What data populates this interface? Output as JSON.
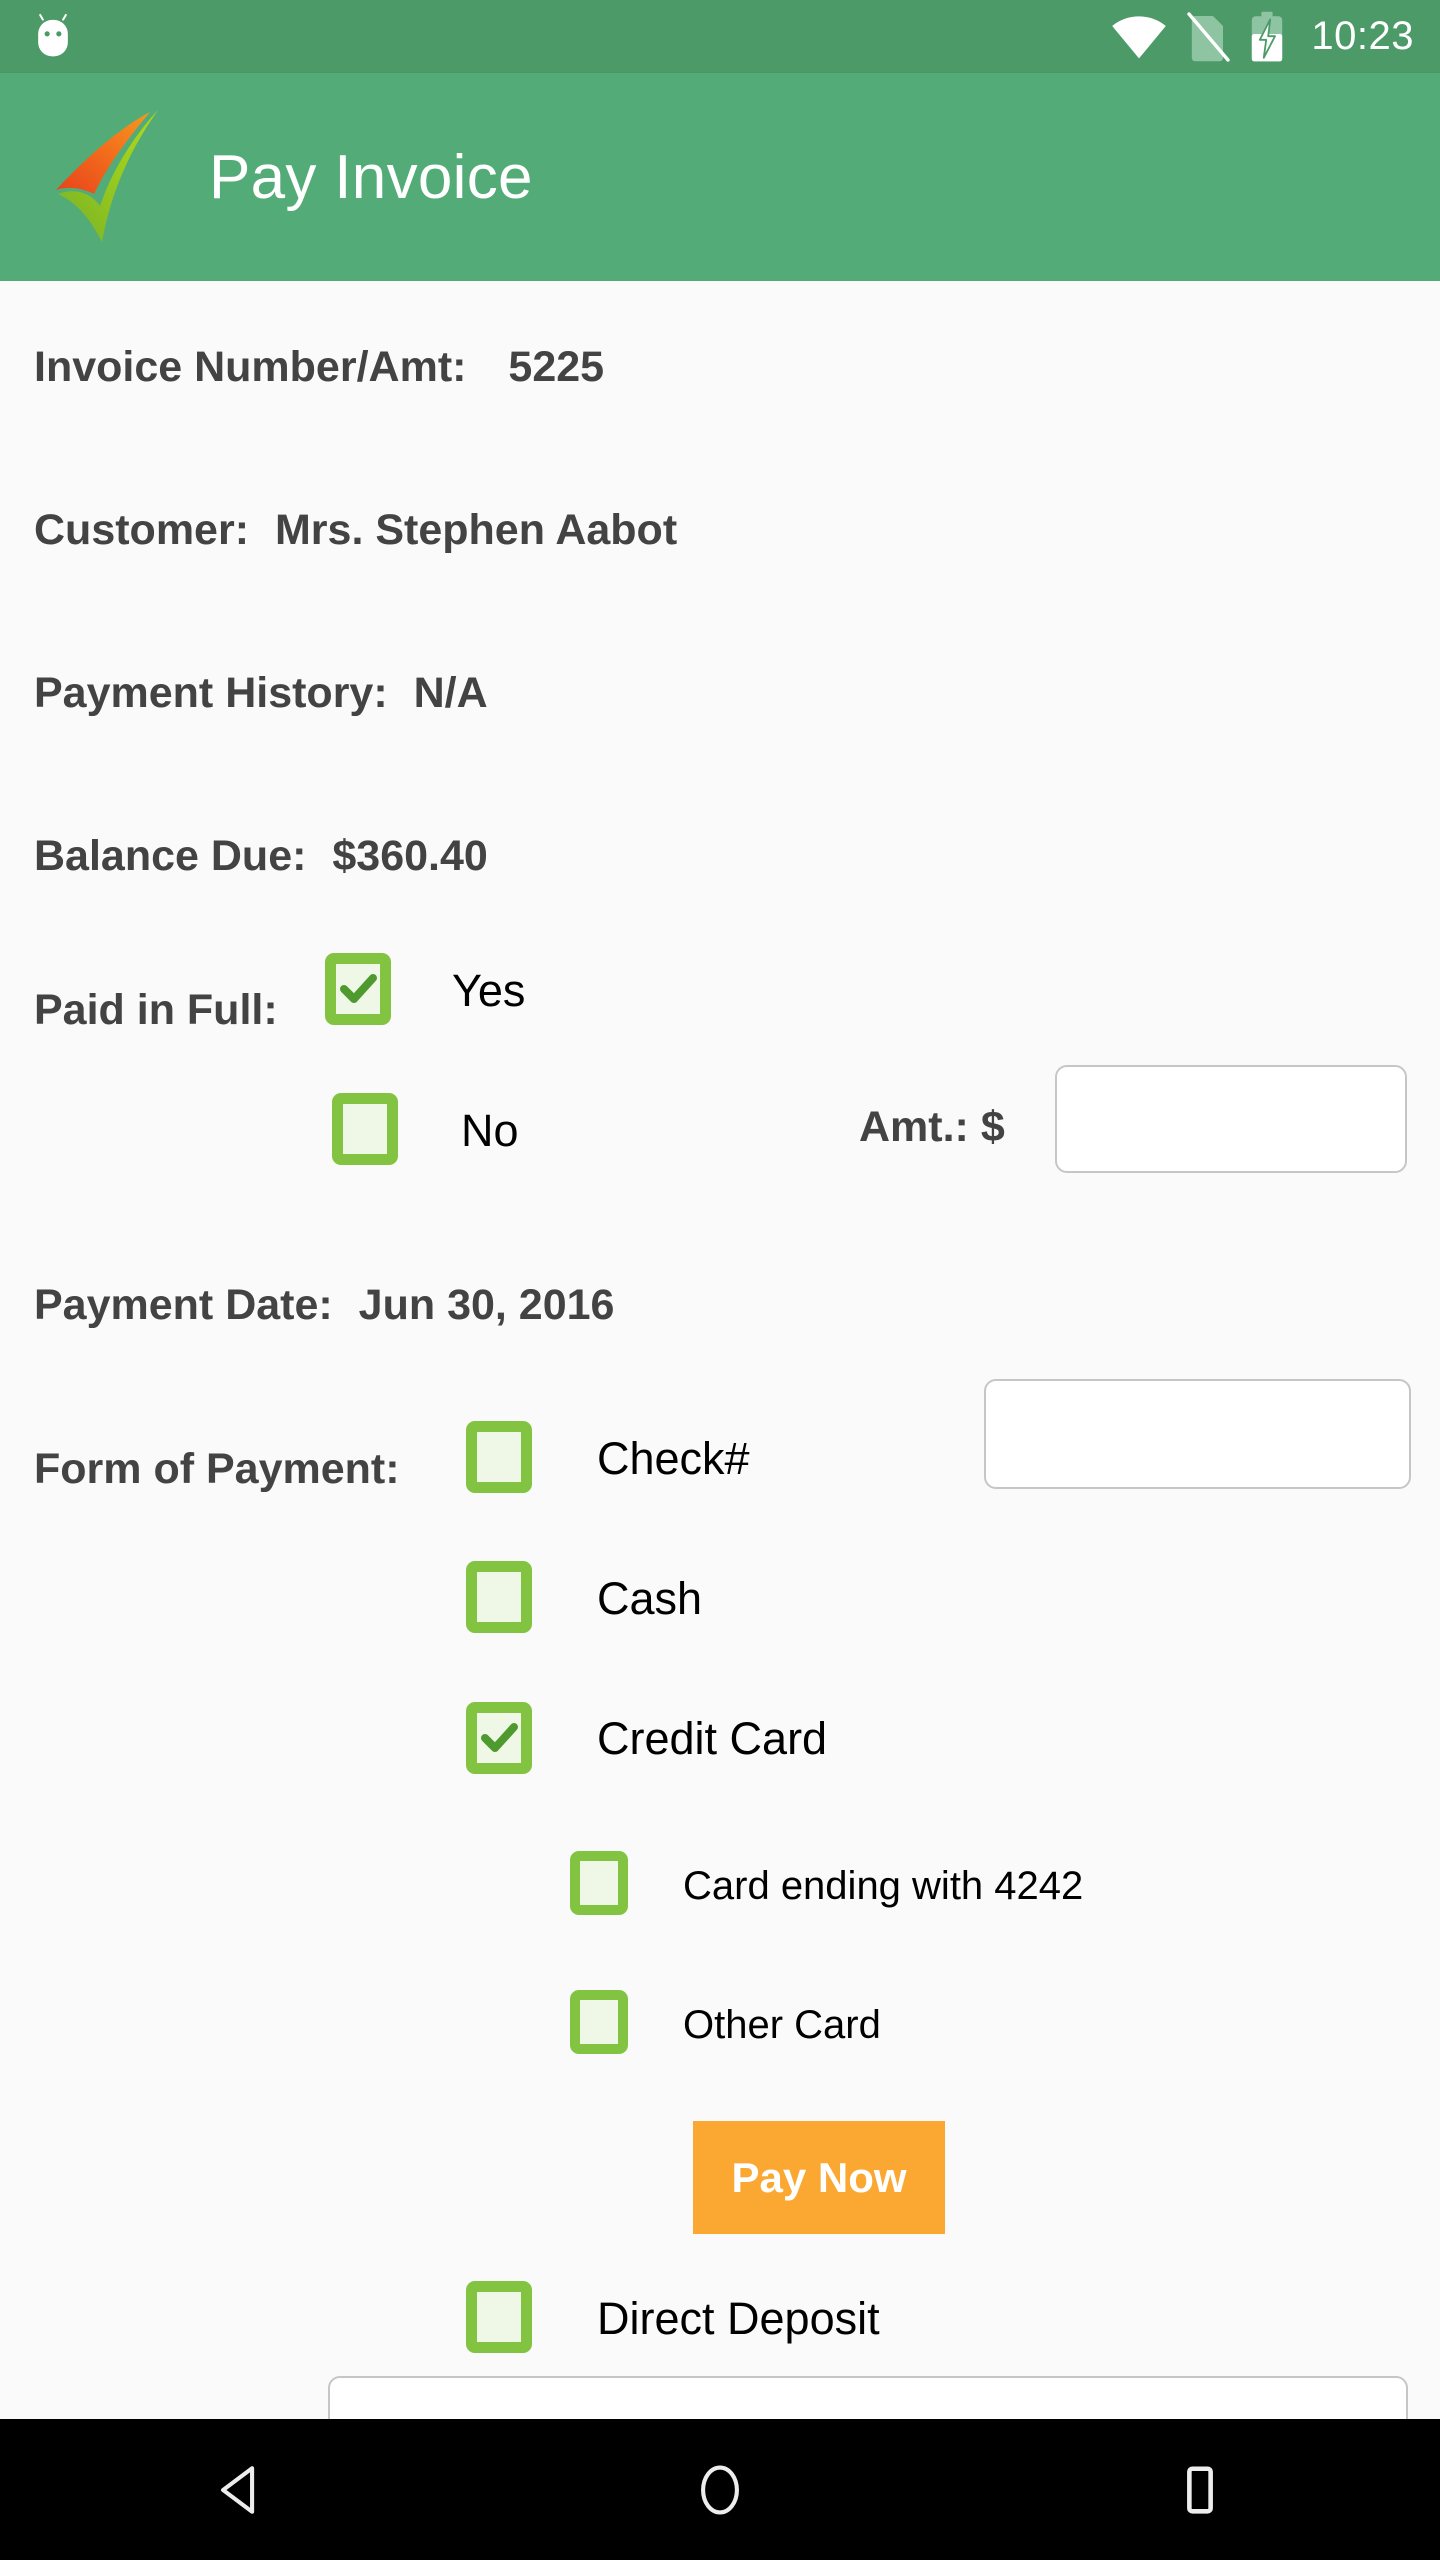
{
  "status_bar": {
    "clock": "10:23",
    "icons": [
      "wifi-icon",
      "no-sim-icon",
      "battery-charging-icon"
    ],
    "background_color": "#4C9A68"
  },
  "app_bar": {
    "title": "Pay Invoice",
    "logo_name": "swoosh-check-logo",
    "background_color": "#53AC77",
    "title_color": "#FFFFFF"
  },
  "form": {
    "invoice": {
      "label": "Invoice Number/Amt:",
      "value": "5225"
    },
    "customer": {
      "label": "Customer:",
      "value": "Mrs. Stephen Aabot"
    },
    "payment_history": {
      "label": "Payment History:",
      "value": "N/A"
    },
    "balance_due": {
      "label": "Balance Due:",
      "value": "$360.40"
    },
    "paid_in_full": {
      "label": "Paid in Full:",
      "options": [
        {
          "label": "Yes",
          "checked": true
        },
        {
          "label": "No",
          "checked": false
        }
      ],
      "amount": {
        "label": "Amt.: $",
        "value": "",
        "placeholder": ""
      }
    },
    "payment_date": {
      "label": "Payment Date:",
      "value": "Jun 30, 2016"
    },
    "form_of_payment": {
      "label": "Form of Payment:",
      "options": [
        {
          "label": "Check#",
          "checked": false
        },
        {
          "label": "Cash",
          "checked": false
        },
        {
          "label": "Credit Card",
          "checked": true
        },
        {
          "label": "Direct Deposit",
          "checked": false
        }
      ],
      "check_number": {
        "value": "",
        "placeholder": ""
      },
      "credit_card_options": [
        {
          "label": "Card ending with 4242",
          "checked": false
        },
        {
          "label": "Other Card",
          "checked": false
        }
      ],
      "pay_now_label": "Pay Now",
      "pay_now_color": "#FBA833",
      "direct_deposit_input": {
        "value": "",
        "placeholder": ""
      }
    }
  },
  "theme": {
    "checkbox_border": "#82C341",
    "checkbox_fill": "#EFF7E7",
    "check_mark": "#4F9A2E",
    "page_background": "#FAFAFA",
    "label_color": "#434343"
  },
  "nav_bar": {
    "back_label": "back-button",
    "home_label": "home-button",
    "recents_label": "recents-button"
  }
}
